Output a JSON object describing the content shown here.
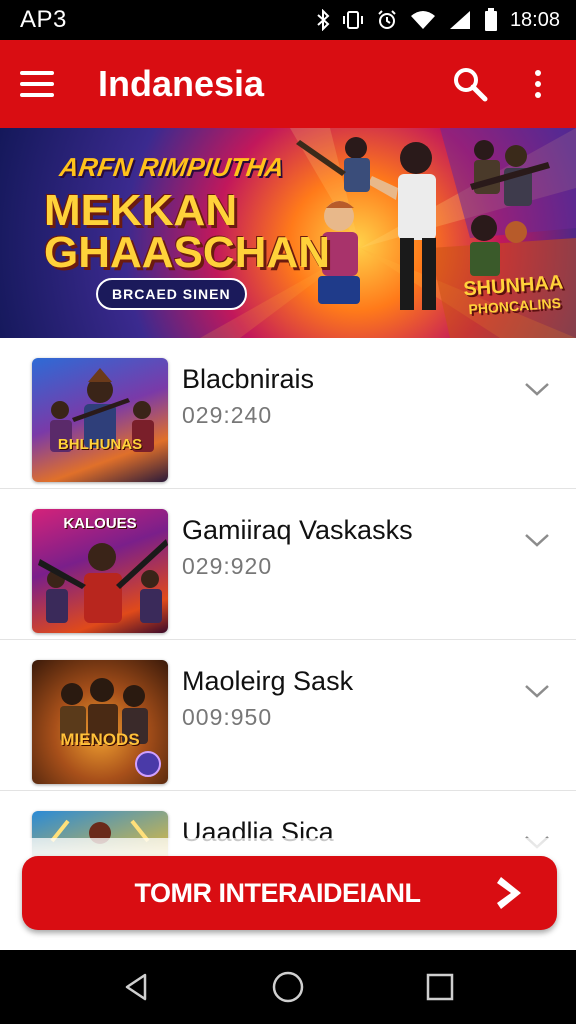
{
  "status_bar": {
    "carrier": "AP3",
    "time": "18:08",
    "icons": [
      "bluetooth-icon",
      "vibrate-icon",
      "alarm-icon",
      "wifi-icon",
      "signal-icon",
      "battery-icon"
    ]
  },
  "app_bar": {
    "title": "Indanesia",
    "menu_icon": "hamburger-menu-icon",
    "search_icon": "search-icon",
    "more_icon": "more-vertical-icon"
  },
  "banner": {
    "tagline": "ARFN RIMPIUTHA",
    "title_line1": "MEKKAN",
    "title_line2": "GHAASCHAN",
    "pill": "BRCAED SINEN",
    "side_line1": "SHUNHAA",
    "side_line2": "PHONCALINS"
  },
  "list": {
    "items": [
      {
        "title": "Blacbnirais",
        "meta": "029:240",
        "thumb_label": "BHLHUNAS"
      },
      {
        "title": "Gamiiraq Vaskasks",
        "meta": "029:920",
        "thumb_label": "KALOUES"
      },
      {
        "title": "Maoleirg Sask",
        "meta": "009:950",
        "thumb_label": "MIENODS"
      },
      {
        "title": "Uaadlia Sica",
        "meta": "",
        "thumb_label": ""
      }
    ]
  },
  "cta": {
    "label": "TOMR INTERAIDEIANL"
  },
  "colors": {
    "brand_red": "#d90d12",
    "status_bg": "#000000",
    "title_text": "#111111",
    "meta_text": "#777777"
  }
}
